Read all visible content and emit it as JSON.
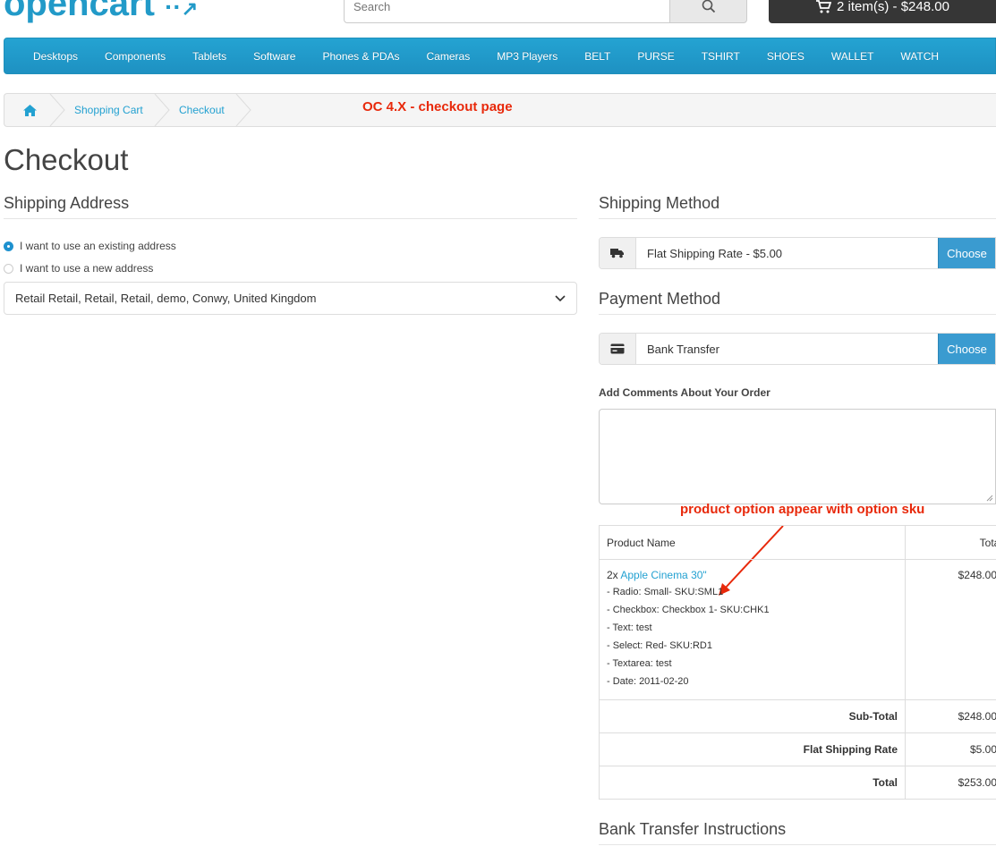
{
  "header": {
    "logo_text": "opencart",
    "search_placeholder": "Search",
    "cart_label": "2 item(s) - $248.00"
  },
  "menu": [
    "Desktops",
    "Components",
    "Tablets",
    "Software",
    "Phones & PDAs",
    "Cameras",
    "MP3 Players",
    "BELT",
    "PURSE",
    "TSHIRT",
    "SHOES",
    "WALLET",
    "WATCH"
  ],
  "breadcrumb": {
    "items": [
      "Shopping Cart",
      "Checkout"
    ]
  },
  "annotations": {
    "top": "OC 4.X - checkout page",
    "table": "product option appear with option sku"
  },
  "page_title": "Checkout",
  "shipping_address": {
    "title": "Shipping Address",
    "radio_existing": "I want to use an existing address",
    "radio_new": "I want to use a new address",
    "selected_address": "Retail Retail, Retail, Retail, demo, Conwy, United Kingdom"
  },
  "shipping_method": {
    "title": "Shipping Method",
    "value": "Flat Shipping Rate - $5.00",
    "button": "Choose"
  },
  "payment_method": {
    "title": "Payment Method",
    "value": "Bank Transfer",
    "button": "Choose"
  },
  "comments_label": "Add Comments About Your Order",
  "order_table": {
    "col_product": "Product Name",
    "col_total": "Total",
    "product_qty": "2x",
    "product_name": "Apple Cinema 30\"",
    "product_total": "$248.00",
    "options": [
      "- Radio: Small- SKU:SML1",
      "- Checkbox: Checkbox 1- SKU:CHK1",
      "- Text: test",
      "- Select: Red- SKU:RD1",
      "- Textarea: test",
      "- Date: 2011-02-20"
    ],
    "totals": [
      {
        "label": "Sub-Total",
        "value": "$248.00"
      },
      {
        "label": "Flat Shipping Rate",
        "value": "$5.00"
      },
      {
        "label": "Total",
        "value": "$253.00"
      }
    ]
  },
  "bank_transfer_title": "Bank Transfer Instructions",
  "colors": {
    "brand": "#229ac8",
    "annotation": "#e8290b",
    "button": "#3a9bd0"
  }
}
